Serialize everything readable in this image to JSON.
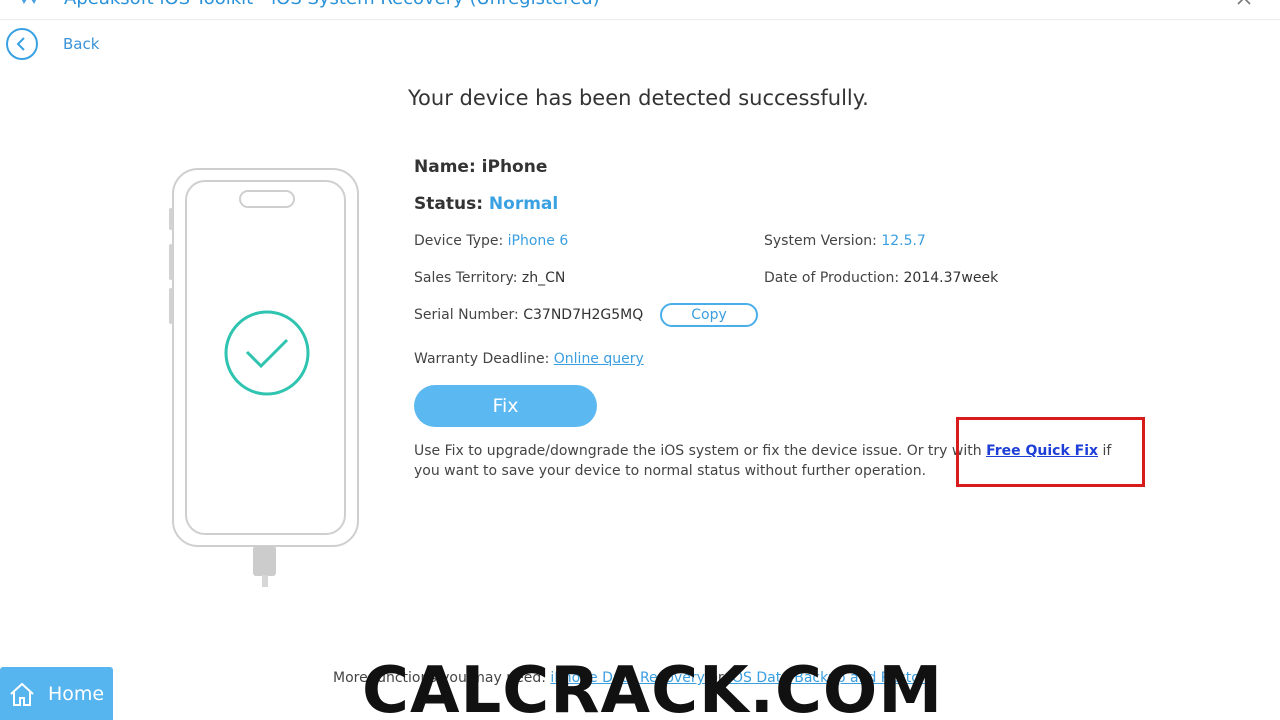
{
  "titlebar": {
    "title": "Apeaksoft iOS Toolkit - iOS System Recovery (Unregistered)"
  },
  "back": {
    "label": "Back"
  },
  "detection": {
    "headline": "Your device has been detected successfully.",
    "name_label": "Name:",
    "name_value": "iPhone",
    "status_label": "Status:",
    "status_value": "Normal",
    "device_type_label": "Device Type:",
    "device_type_value": "iPhone 6",
    "system_version_label": "System Version:",
    "system_version_value": "12.5.7",
    "sales_territory_label": "Sales Territory:",
    "sales_territory_value": "zh_CN",
    "date_production_label": "Date of Production:",
    "date_production_value": "2014.37week",
    "serial_label": "Serial Number:",
    "serial_value": "C37ND7H2G5MQ",
    "copy_label": "Copy",
    "warranty_label": "Warranty Deadline:",
    "warranty_link": "Online query"
  },
  "fix": {
    "label": "Fix"
  },
  "note": {
    "text_before": "Use Fix to upgrade/downgrade the iOS system or fix the device issue. Or try with ",
    "link": "Free Quick Fix",
    "text_after": " if you want to save your device to normal status without further operation."
  },
  "home": {
    "label": "Home"
  },
  "more": {
    "prefix": "More functions you may need: ",
    "link1": "iPhone Data Recovery",
    "middle": " or ",
    "link2": "iOS Data Backup and Restore"
  },
  "watermark": "CALCRACK.COM",
  "colors": {
    "accent": "#3aa1e3",
    "button": "#5bb8f0",
    "highlight": "#d81b1b",
    "check": "#2ec4b0"
  }
}
